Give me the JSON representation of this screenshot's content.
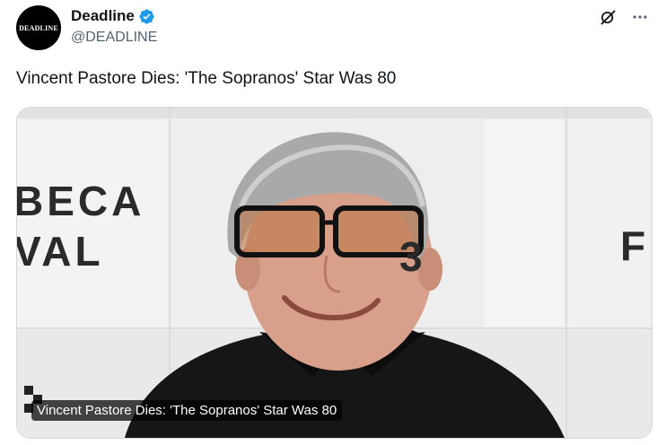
{
  "author": {
    "avatar_text": "DEADLINE",
    "display_name": "Deadline",
    "verified": true,
    "handle": "@DEADLINE"
  },
  "actions": {
    "grok_icon": "grok-icon",
    "more_icon": "more-options-icon",
    "more_label": "•••"
  },
  "tweet": {
    "text": "Vincent Pastore Dies: 'The Sopranos' Star Was 80"
  },
  "card": {
    "image_backdrop_text_left": "BECA\nVAL",
    "backdrop_left_line1": "BECA",
    "backdrop_left_line2": "VAL",
    "backdrop_right": "F",
    "backdrop_mid": "3",
    "caption": "Vincent Pastore Dies: 'The Sopranos' Star Was 80"
  },
  "colors": {
    "text_primary": "#0f1419",
    "text_secondary": "#536471",
    "verified_blue": "#1d9bf0",
    "card_border": "#cfd9de"
  }
}
